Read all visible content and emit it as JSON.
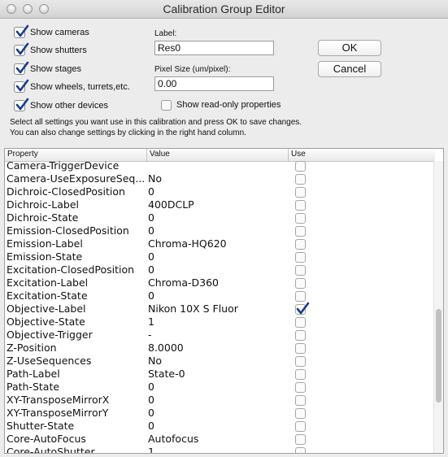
{
  "window": {
    "title": "Calibration Group Editor"
  },
  "show_options": [
    {
      "label": "Show cameras",
      "checked": true
    },
    {
      "label": "Show shutters",
      "checked": true
    },
    {
      "label": "Show stages",
      "checked": true
    },
    {
      "label": "Show wheels, turrets,etc.",
      "checked": true
    },
    {
      "label": "Show other devices",
      "checked": true
    }
  ],
  "form": {
    "label_caption": "Label:",
    "label_value": "Res0",
    "pixel_caption": "Pixel Size (um/pixel):",
    "pixel_value": "0.00",
    "readonly_label": "Show read-only properties",
    "readonly_checked": false
  },
  "buttons": {
    "ok": "OK",
    "cancel": "Cancel"
  },
  "instructions": {
    "line1": "Select all settings you want use in this calibration and press OK to save changes.",
    "line2": "You can also change settings by clicking in the right hand column."
  },
  "table": {
    "headers": {
      "property": "Property",
      "value": "Value",
      "use": "Use"
    },
    "rows": [
      {
        "property": "Camera-TriggerDevice",
        "value": "",
        "use": false
      },
      {
        "property": "Camera-UseExposureSeq...",
        "value": "No",
        "use": false
      },
      {
        "property": "Dichroic-ClosedPosition",
        "value": "0",
        "use": false
      },
      {
        "property": "Dichroic-Label",
        "value": "400DCLP",
        "use": false
      },
      {
        "property": "Dichroic-State",
        "value": "0",
        "use": false
      },
      {
        "property": "Emission-ClosedPosition",
        "value": "0",
        "use": false
      },
      {
        "property": "Emission-Label",
        "value": "Chroma-HQ620",
        "use": false
      },
      {
        "property": "Emission-State",
        "value": "0",
        "use": false
      },
      {
        "property": "Excitation-ClosedPosition",
        "value": "0",
        "use": false
      },
      {
        "property": "Excitation-Label",
        "value": "Chroma-D360",
        "use": false
      },
      {
        "property": "Excitation-State",
        "value": "0",
        "use": false
      },
      {
        "property": "Objective-Label",
        "value": "Nikon 10X S Fluor",
        "use": true
      },
      {
        "property": "Objective-State",
        "value": "1",
        "use": false
      },
      {
        "property": "Objective-Trigger",
        "value": "-",
        "use": false
      },
      {
        "property": "Z-Position",
        "value": "8.0000",
        "use": false
      },
      {
        "property": "Z-UseSequences",
        "value": "No",
        "use": false
      },
      {
        "property": "Path-Label",
        "value": "State-0",
        "use": false
      },
      {
        "property": "Path-State",
        "value": "0",
        "use": false
      },
      {
        "property": "XY-TransposeMirrorX",
        "value": "0",
        "use": false
      },
      {
        "property": "XY-TransposeMirrorY",
        "value": "0",
        "use": false
      },
      {
        "property": "Shutter-State",
        "value": "0",
        "use": false
      },
      {
        "property": "Core-AutoFocus",
        "value": "Autofocus",
        "use": false
      },
      {
        "property": "Core-AutoShutter",
        "value": "1",
        "use": false
      }
    ]
  },
  "colors": {
    "check": "#1a3c8c",
    "window_bg": "#ececec"
  }
}
